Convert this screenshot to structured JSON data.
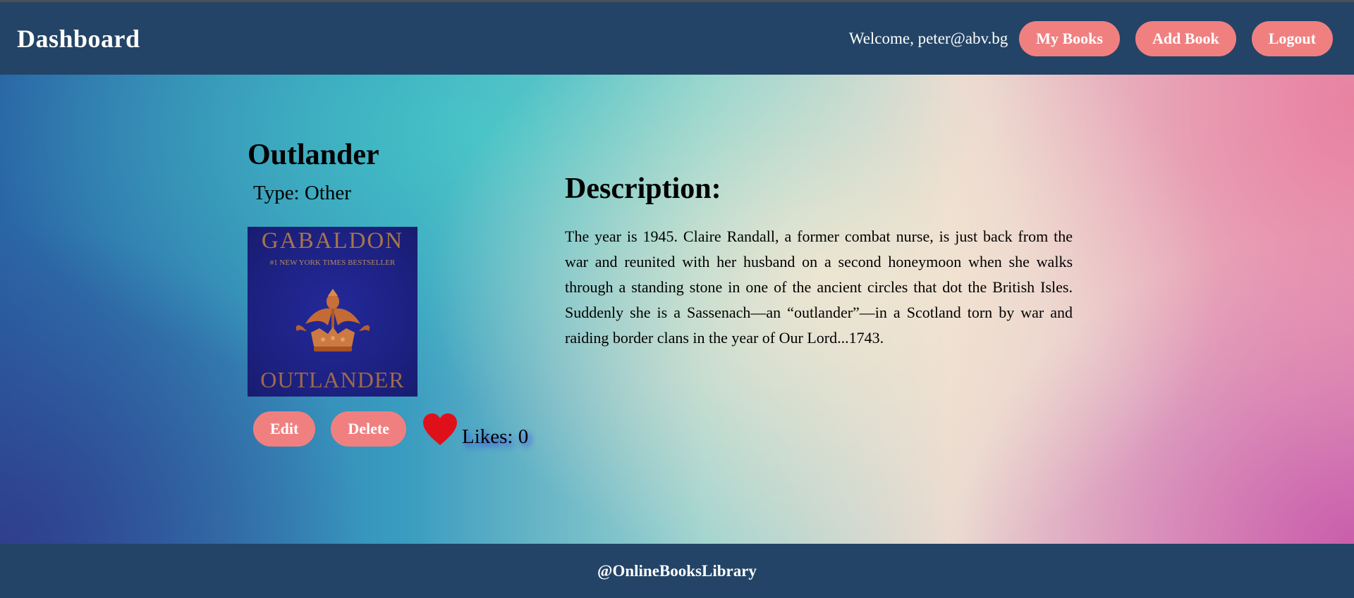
{
  "header": {
    "brand": "Dashboard",
    "welcome": "Welcome, peter@abv.bg",
    "nav": {
      "my_books": "My Books",
      "add_book": "Add Book",
      "logout": "Logout"
    }
  },
  "book": {
    "title": "Outlander",
    "type_line": "Type: Other",
    "cover": {
      "author": "GABALDON",
      "tagline": "#1 NEW YORK TIMES BESTSELLER",
      "name": "OUTLANDER"
    },
    "actions": {
      "edit": "Edit",
      "delete": "Delete",
      "like_icon": "heart-icon",
      "likes": "Likes: 0"
    },
    "description_heading": "Description:",
    "description": "The year is 1945. Claire Randall, a former combat nurse, is just back from the war and reunited with her husband on a second honeymoon when she walks through a standing stone in one of the ancient circles that dot the British Isles. Suddenly she is a Sassenach—an “outlander”—in a Scotland torn by war and raiding border clans in the year of Our Lord...1743."
  },
  "footer": {
    "copyright": "@OnlineBooksLibrary"
  },
  "colors": {
    "navbar": "#234466",
    "button": "#f08080",
    "heart": "#e0101a",
    "cover": "#1c207e"
  }
}
